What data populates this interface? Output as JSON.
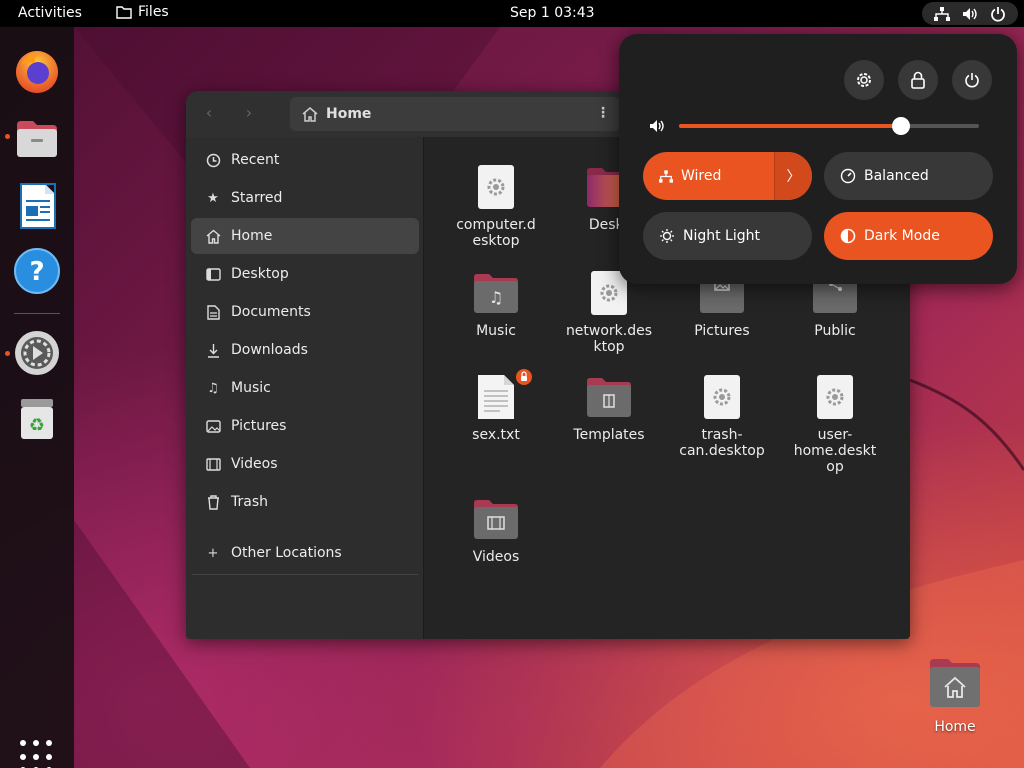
{
  "topbar": {
    "activities": "Activities",
    "app_name": "Files",
    "clock": "Sep 1  03:43"
  },
  "dock": {
    "apps": [
      "Firefox",
      "Files",
      "LibreOffice Writer",
      "Help",
      "Settings",
      "Trash"
    ]
  },
  "files": {
    "path": "Home",
    "sidebar": [
      {
        "label": "Recent",
        "icon": "clock-icon"
      },
      {
        "label": "Starred",
        "icon": "star-icon"
      },
      {
        "label": "Home",
        "icon": "home-icon"
      },
      {
        "label": "Desktop",
        "icon": "desktop-icon"
      },
      {
        "label": "Documents",
        "icon": "document-icon"
      },
      {
        "label": "Downloads",
        "icon": "download-icon"
      },
      {
        "label": "Music",
        "icon": "music-icon"
      },
      {
        "label": "Pictures",
        "icon": "picture-icon"
      },
      {
        "label": "Videos",
        "icon": "video-icon"
      },
      {
        "label": "Trash",
        "icon": "trash-icon"
      },
      {
        "label": "Other Locations",
        "icon": "plus-icon"
      }
    ],
    "items": [
      {
        "label": "computer.d\nesktop",
        "type": "desktop-file"
      },
      {
        "label": "Deskt",
        "type": "folder"
      },
      {
        "label": "Music",
        "type": "folder"
      },
      {
        "label": "network.des\nktop",
        "type": "desktop-file"
      },
      {
        "label": "Pictures",
        "type": "folder"
      },
      {
        "label": "Public",
        "type": "folder"
      },
      {
        "label": "sex.txt",
        "type": "text-file"
      },
      {
        "label": "Templates",
        "type": "folder"
      },
      {
        "label": "trash-\ncan.desktop",
        "type": "desktop-file"
      },
      {
        "label": "user-\nhome.deskt\nop",
        "type": "desktop-file"
      },
      {
        "label": "Videos",
        "type": "folder"
      }
    ]
  },
  "quick_settings": {
    "volume_level": 0.74,
    "wired": "Wired",
    "balanced": "Balanced",
    "night_light": "Night Light",
    "dark_mode": "Dark Mode",
    "accent": "#e95420"
  },
  "desktop": {
    "home_label": "Home"
  }
}
